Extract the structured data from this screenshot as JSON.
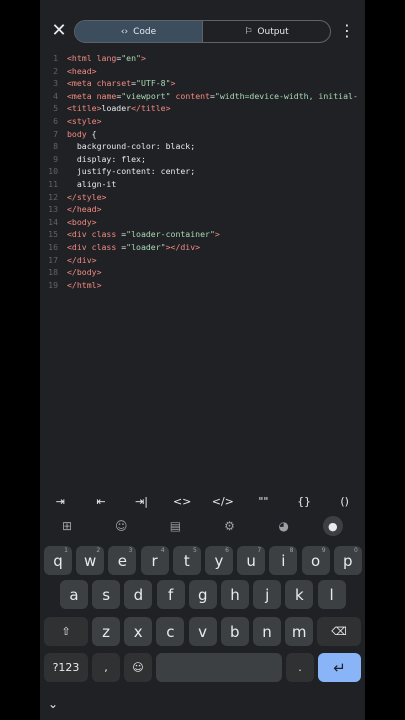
{
  "topbar": {
    "close_icon": "close-icon",
    "code_label": "Code",
    "output_label": "Output",
    "more_icon": "more-vert-icon"
  },
  "editor": {
    "lines": [
      {
        "n": "1",
        "parts": [
          [
            "tag",
            "<html"
          ],
          [
            "attr",
            " lang"
          ],
          [
            "plain",
            "="
          ],
          [
            "str",
            "\"en\""
          ],
          [
            "tag",
            ">"
          ]
        ]
      },
      {
        "n": "2",
        "parts": [
          [
            "tag",
            "<head>"
          ]
        ]
      },
      {
        "n": "3",
        "parts": [
          [
            "tag",
            "<meta"
          ],
          [
            "attr",
            " charset"
          ],
          [
            "plain",
            "="
          ],
          [
            "str",
            "\"UTF-8\""
          ],
          [
            "tag",
            ">"
          ]
        ]
      },
      {
        "n": "4",
        "parts": [
          [
            "tag",
            "<meta"
          ],
          [
            "attr",
            " name"
          ],
          [
            "plain",
            "="
          ],
          [
            "str",
            "\"viewport\""
          ],
          [
            "attr",
            " content"
          ],
          [
            "plain",
            "="
          ],
          [
            "str",
            "\"width=device-width, initial-"
          ]
        ]
      },
      {
        "n": "5",
        "parts": [
          [
            "tag",
            "<title>"
          ],
          [
            "plain",
            "loader"
          ],
          [
            "tag",
            "</title>"
          ]
        ]
      },
      {
        "n": "6",
        "parts": [
          [
            "tag",
            "<style>"
          ]
        ]
      },
      {
        "n": "7",
        "parts": [
          [
            "kw",
            "body"
          ],
          [
            "plain",
            " {"
          ]
        ]
      },
      {
        "n": "8",
        "parts": [
          [
            "plain",
            "  background-color: black;"
          ]
        ]
      },
      {
        "n": "9",
        "parts": [
          [
            "plain",
            "  display: flex;"
          ]
        ]
      },
      {
        "n": "10",
        "parts": [
          [
            "plain",
            "  justify-content: center;"
          ]
        ]
      },
      {
        "n": "11",
        "parts": [
          [
            "plain",
            "  align-it"
          ]
        ]
      },
      {
        "n": "12",
        "parts": [
          [
            "tag",
            "</style>"
          ]
        ]
      },
      {
        "n": "13",
        "parts": [
          [
            "tag",
            "</head>"
          ]
        ]
      },
      {
        "n": "14",
        "parts": [
          [
            "tag",
            "<body>"
          ]
        ]
      },
      {
        "n": "15",
        "parts": [
          [
            "tag",
            "<div"
          ],
          [
            "attr",
            " class"
          ],
          [
            "plain",
            " ="
          ],
          [
            "str",
            "\"loader-container\""
          ],
          [
            "tag",
            ">"
          ]
        ]
      },
      {
        "n": "16",
        "parts": [
          [
            "tag",
            "<div"
          ],
          [
            "attr",
            " class"
          ],
          [
            "plain",
            " ="
          ],
          [
            "str",
            "\"loader\""
          ],
          [
            "tag",
            "></div>"
          ]
        ]
      },
      {
        "n": "17",
        "parts": [
          [
            "tag",
            "</div>"
          ]
        ]
      },
      {
        "n": "18",
        "parts": [
          [
            "tag",
            "</body>"
          ]
        ]
      },
      {
        "n": "19",
        "parts": [
          [
            "tag",
            "</html>"
          ]
        ]
      }
    ]
  },
  "symbols": [
    "⇥",
    "⇤",
    "⇥|",
    "<>",
    "</>",
    "\"\"",
    "{}",
    "()"
  ],
  "keyboard": {
    "toolbar_icons": [
      "grid-icon",
      "sticker-icon",
      "clipboard-icon",
      "settings-icon",
      "palette-icon",
      "mic-icon"
    ],
    "row1": [
      [
        "q",
        "1"
      ],
      [
        "w",
        "2"
      ],
      [
        "e",
        "3"
      ],
      [
        "r",
        "4"
      ],
      [
        "t",
        "5"
      ],
      [
        "y",
        "6"
      ],
      [
        "u",
        "7"
      ],
      [
        "i",
        "8"
      ],
      [
        "o",
        "9"
      ],
      [
        "p",
        "0"
      ]
    ],
    "row2": [
      "a",
      "s",
      "d",
      "f",
      "g",
      "h",
      "j",
      "k",
      "l"
    ],
    "row3": [
      "z",
      "x",
      "c",
      "v",
      "b",
      "n",
      "m"
    ],
    "symbols_key": "?123",
    "comma": ",",
    "period": "."
  }
}
